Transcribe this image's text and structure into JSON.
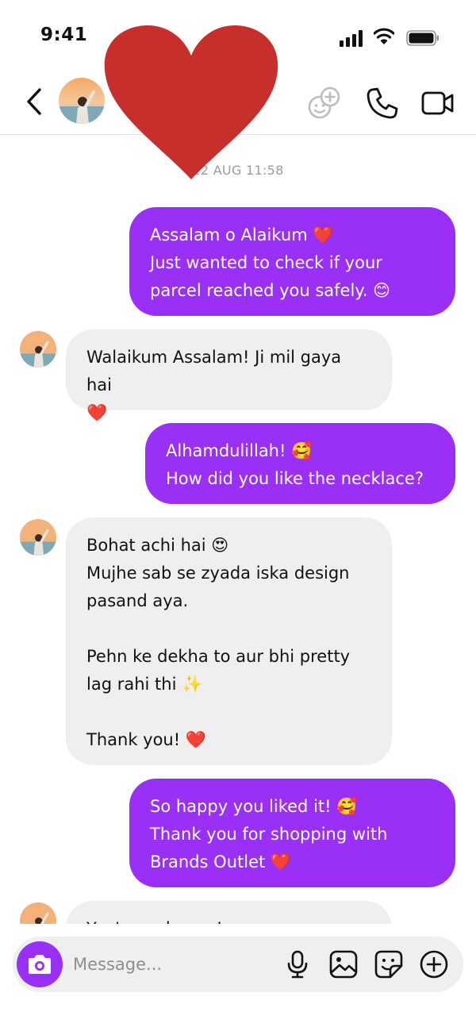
{
  "status_bar": {
    "time": "9:41"
  },
  "header": {
    "icons": [
      "back-chevron-icon",
      "contact-avatar",
      "heart-sticker",
      "video-chat-effects-icon",
      "phone-icon",
      "video-camera-icon"
    ]
  },
  "conversation": {
    "timestamp": "22 AUG 11:58",
    "messages": [
      {
        "direction": "sent",
        "text": "Assalam o Alaikum ❤️\nJust wanted to check if your\nparcel reached you safely. 😊"
      },
      {
        "direction": "received",
        "text": "Walaikum Assalam! Ji mil gaya hai\n❤️"
      },
      {
        "direction": "sent",
        "text": "Alhamdulillah! 🥰\nHow did you like the necklace?"
      },
      {
        "direction": "received",
        "text": "Bohat achi hai 😍\nMujhe sab se zyada iska design\npasand aya.\n\nPehn ke dekha to aur bhi pretty\nlag rahi thi ✨\n\nThank you! ❤️"
      },
      {
        "direction": "sent",
        "text": "So happy you liked it! 🥰\nThank you for shopping with\nBrands Outlet ❤️"
      },
      {
        "direction": "received",
        "text": "You're welcome!"
      }
    ]
  },
  "composer": {
    "placeholder": "Message...",
    "icons": [
      "camera-icon",
      "microphone-icon",
      "gallery-icon",
      "sticker-icon",
      "plus-icon"
    ]
  },
  "colors": {
    "accent": "#9a2ff5",
    "incoming_bubble": "#efefef",
    "heart": "#c62f2c",
    "timestamp": "#9b9b9b"
  }
}
